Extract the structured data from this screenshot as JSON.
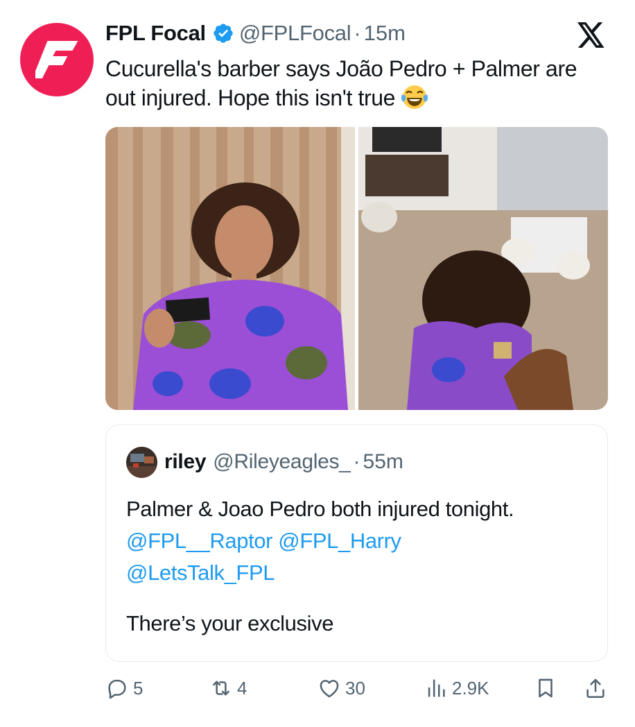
{
  "tweet": {
    "author": {
      "name": "FPL Focal",
      "handle": "@FPLFocal",
      "verified": true,
      "avatar_color": "#ef1f55",
      "avatar_letter": "F"
    },
    "separator": "·",
    "time": "15m",
    "text": "Cucurella's barber says João Pedro + Palmer are out injured. Hope this isn't true",
    "emoji": "face-with-tears-of-joy",
    "platform_icon": "x-logo-icon",
    "media": [
      {
        "icon": "photo-man-with-business-card"
      },
      {
        "icon": "photo-haircut-from-behind"
      }
    ]
  },
  "quote": {
    "author": {
      "name": "riley",
      "handle": "@Rileyeagles_"
    },
    "separator": "·",
    "time": "55m",
    "line1": "Palmer & Joao Pedro both injured tonight.",
    "mentions": [
      "@FPL__Raptor",
      "@FPL_Harry",
      "@LetsTalk_FPL"
    ],
    "closing": "There’s your exclusive"
  },
  "actions": {
    "replies": "5",
    "reposts": "4",
    "likes": "30",
    "views": "2.9K"
  },
  "colors": {
    "accent_link": "#1d9bf0",
    "verified_badge": "#1d9bf0",
    "muted_text": "#536471",
    "border": "#e6ebef"
  }
}
